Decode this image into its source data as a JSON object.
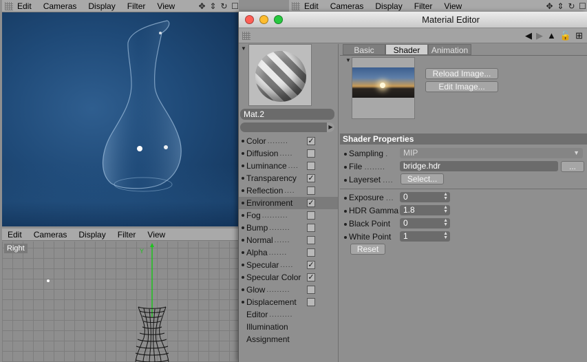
{
  "viewport_top": {
    "menu": [
      "Edit",
      "Cameras",
      "Display",
      "Filter",
      "View"
    ]
  },
  "viewport_right_menu": {
    "menu": [
      "Edit",
      "Cameras",
      "Display",
      "Filter",
      "View"
    ]
  },
  "viewport_bottom": {
    "menu": [
      "Edit",
      "Cameras",
      "Display",
      "Filter",
      "View"
    ],
    "label": "Right",
    "axis_label": "Y"
  },
  "view_icons": [
    "✥",
    "⇕",
    "↻",
    "☐"
  ],
  "material_editor": {
    "title": "Material Editor",
    "material_name": "Mat.2",
    "channels": [
      {
        "label": "Color",
        "checked": true,
        "dots": "........"
      },
      {
        "label": "Diffusion",
        "checked": false,
        "dots": "....."
      },
      {
        "label": "Luminance",
        "checked": false,
        "dots": "...."
      },
      {
        "label": "Transparency",
        "checked": true,
        "dots": ""
      },
      {
        "label": "Reflection",
        "checked": false,
        "dots": "...."
      },
      {
        "label": "Environment",
        "checked": true,
        "dots": ""
      },
      {
        "label": "Fog",
        "checked": false,
        "dots": ".........."
      },
      {
        "label": "Bump",
        "checked": false,
        "dots": "........"
      },
      {
        "label": "Normal",
        "checked": false,
        "dots": "......"
      },
      {
        "label": "Alpha",
        "checked": false,
        "dots": "......."
      },
      {
        "label": "Specular",
        "checked": true,
        "dots": "....."
      },
      {
        "label": "Specular Color",
        "checked": true,
        "dots": ""
      },
      {
        "label": "Glow",
        "checked": false,
        "dots": "........."
      },
      {
        "label": "Displacement",
        "checked": false,
        "dots": ""
      }
    ],
    "extra_items": [
      {
        "label": "Editor",
        "dots": "........."
      },
      {
        "label": "Illumination",
        "dots": ""
      },
      {
        "label": "Assignment",
        "dots": ""
      }
    ],
    "selected_channel": "Environment",
    "tabs": [
      "Basic",
      "Shader",
      "Animation"
    ],
    "active_tab": "Shader",
    "buttons": {
      "reload": "Reload Image...",
      "edit": "Edit Image...",
      "select": "Select...",
      "reset": "Reset",
      "browse": "..."
    },
    "section_title": "Shader Properties",
    "props": {
      "sampling": {
        "label": "Sampling",
        "dots": ".",
        "value": "MIP"
      },
      "file": {
        "label": "File",
        "dots": "........",
        "value": "bridge.hdr"
      },
      "layerset": {
        "label": "Layerset",
        "dots": "...."
      },
      "exposure": {
        "label": "Exposure",
        "dots": "...",
        "value": "0"
      },
      "hdr_gamma": {
        "label": "HDR Gamma",
        "value": "1.8"
      },
      "black_point": {
        "label": "Black Point",
        "value": "0"
      },
      "white_point": {
        "label": "White Point",
        "value": "1"
      }
    },
    "colors": {
      "traffic_close": "#ff5f56",
      "traffic_min": "#ffbd2e",
      "traffic_max": "#27c93f"
    }
  }
}
